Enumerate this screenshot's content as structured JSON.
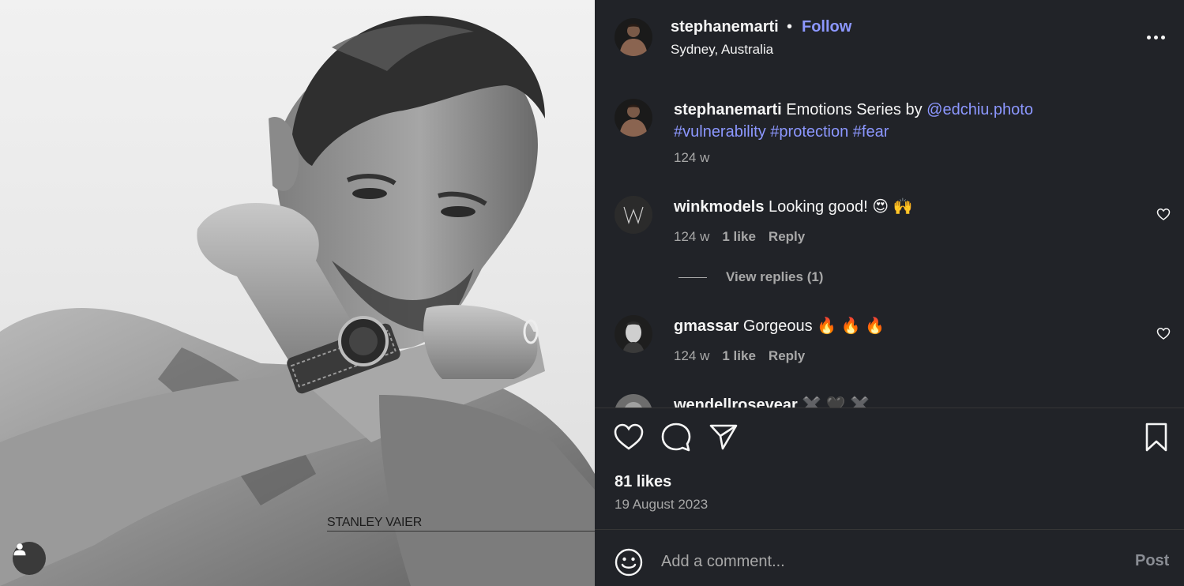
{
  "post": {
    "username": "stephanemarti",
    "separator": "•",
    "follow_label": "Follow",
    "location": "Sydney, Australia",
    "more_icon": "more-horizontal-icon",
    "image": {
      "watermark": "STANLEY VAIER",
      "tag_icon": "user-tag-icon"
    }
  },
  "caption": {
    "username": "stephanemarti",
    "text": "Emotions Series by",
    "mention": "@edchiu.photo",
    "hashtags": "#vulnerability #protection #fear",
    "time": "124 w"
  },
  "comments": [
    {
      "username": "winkmodels",
      "text": "Looking good!",
      "emojis": "😍 🙌",
      "time": "124 w",
      "likes": "1 like",
      "reply_label": "Reply",
      "view_replies": "View replies (1)"
    },
    {
      "username": "gmassar",
      "text": "Gorgeous",
      "emojis": "🔥 🔥 🔥",
      "time": "124 w",
      "likes": "1 like",
      "reply_label": "Reply"
    },
    {
      "username": "wendellrosevear",
      "emojis": "✖️ 🖤 ✖️"
    }
  ],
  "actions": {
    "like_icon": "heart-icon",
    "comment_icon": "comment-icon",
    "share_icon": "send-icon",
    "save_icon": "bookmark-icon"
  },
  "likes": "81 likes",
  "date": "19 August 2023",
  "composer": {
    "placeholder": "Add a comment...",
    "post_label": "Post",
    "emoji_icon": "smiley-icon"
  },
  "colors": {
    "panel_bg": "#212328",
    "link": "#8c97ff",
    "muted": "#a8a8a8",
    "divider": "#363636"
  }
}
